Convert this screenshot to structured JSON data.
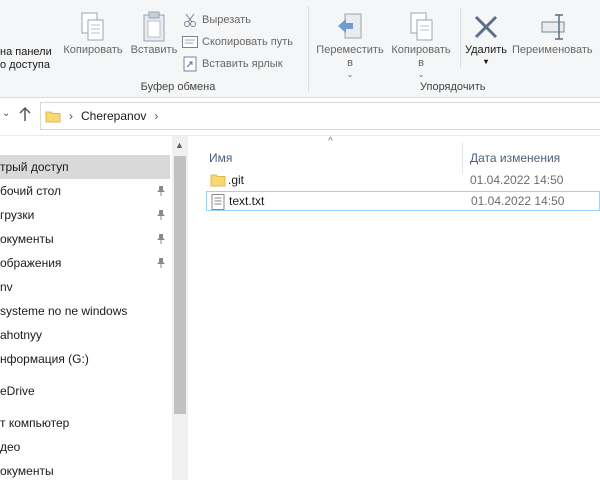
{
  "ribbon": {
    "pin_panel": {
      "label_line1": "на панели",
      "label_line2": "о доступа"
    },
    "copy": {
      "label": "Копировать"
    },
    "paste": {
      "label": "Вставить"
    },
    "cut": {
      "label": "Вырезать"
    },
    "copy_path": {
      "label": "Скопировать путь"
    },
    "paste_shortcut": {
      "label": "Вставить ярлык"
    },
    "clipboard_group": "Буфер обмена",
    "move_to": {
      "label_line1": "Переместить",
      "label_line2": "в"
    },
    "copy_to": {
      "label_line1": "Копировать",
      "label_line2": "в"
    },
    "delete": {
      "label": "Удалить"
    },
    "rename": {
      "label": "Переименовать"
    },
    "organize_group": "Упорядочить"
  },
  "address": {
    "crumbs": [
      "Cherepanov"
    ]
  },
  "navigation": {
    "items": [
      {
        "label": "трый доступ",
        "selected": true,
        "pinned": false
      },
      {
        "label": "бочий стол",
        "selected": false,
        "pinned": true
      },
      {
        "label": "грузки",
        "selected": false,
        "pinned": true
      },
      {
        "label": "окументы",
        "selected": false,
        "pinned": true
      },
      {
        "label": "ображения",
        "selected": false,
        "pinned": true
      },
      {
        "label": "nv",
        "selected": false,
        "pinned": false
      },
      {
        "label": "systeme no ne windows",
        "selected": false,
        "pinned": false
      },
      {
        "label": "ahotnyy",
        "selected": false,
        "pinned": false
      },
      {
        "label": "нформация (G:)",
        "selected": false,
        "pinned": false
      },
      {
        "label": "eDrive",
        "selected": false,
        "pinned": false
      },
      {
        "label": "т компьютер",
        "selected": false,
        "pinned": false
      },
      {
        "label": "део",
        "selected": false,
        "pinned": false
      },
      {
        "label": "окументы",
        "selected": false,
        "pinned": false
      }
    ]
  },
  "filelist": {
    "columns": {
      "name": "Имя",
      "date_modified": "Дата изменения"
    },
    "rows": [
      {
        "name": ".git",
        "type": "folder",
        "date": "01.04.2022 14:50"
      },
      {
        "name": "text.txt",
        "type": "text-file",
        "date": "01.04.2022 14:50"
      }
    ]
  },
  "colors": {
    "ribbon_bg": "#f5f6f7",
    "selected_nav_bg": "#d9d9d9",
    "header_text": "#4c607a",
    "folder_yellow": "#f8d775",
    "focus_border": "#99d1ff"
  }
}
